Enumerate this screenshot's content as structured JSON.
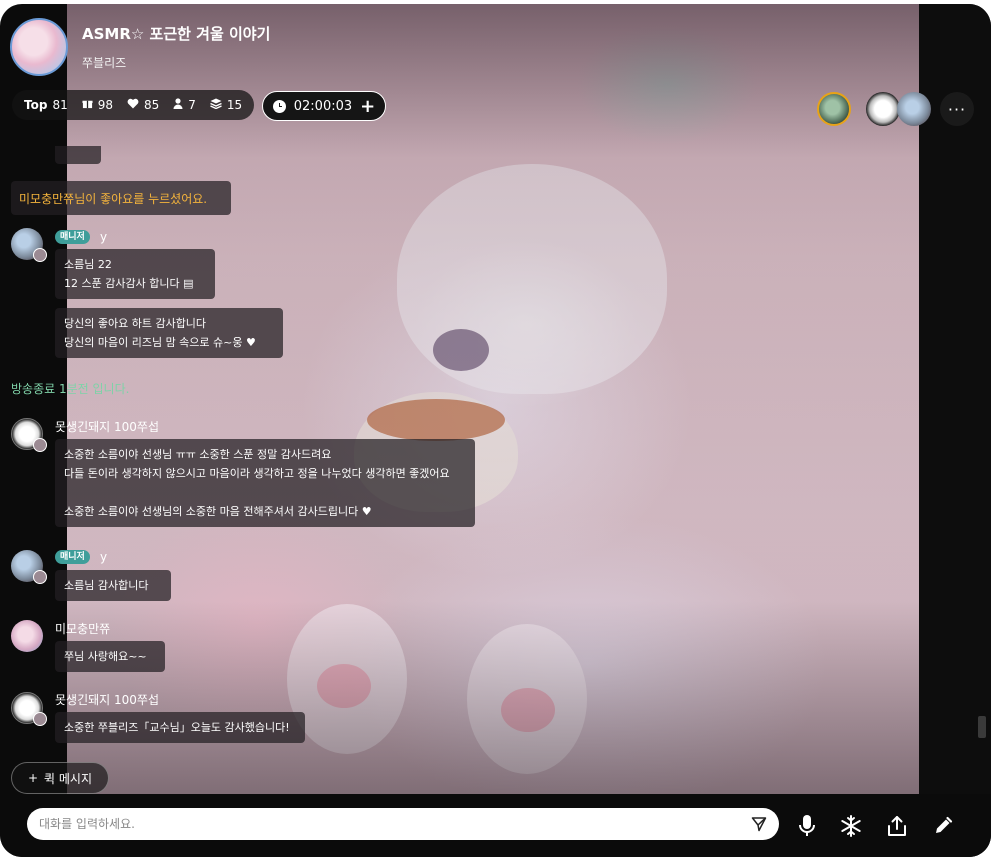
{
  "header": {
    "title": "ASMR☆ 포근한 겨울 이야기",
    "streamer": "쭈블리즈"
  },
  "stats": {
    "top_label": "Top",
    "top_value": "81",
    "gift": "98",
    "likes": "85",
    "viewers": "7",
    "layers": "15"
  },
  "timer": {
    "time": "02:00:03",
    "plus": "+"
  },
  "more": {
    "label": "···"
  },
  "chat": {
    "like_notice": "미모충만쮸님이 좋아요를 누르셨어요.",
    "manager_tag": "매니저",
    "msg1": {
      "name": "y",
      "bubble1": "소름님 22\n12 스푼 감사감사 합니다 ▤",
      "bubble2": "당신의 좋아요 하트 감사합니다\n당신의 마음이 리즈님 맘 속으로 슈~웅 ♥"
    },
    "end_notice": "방송종료 1분전 입니다.",
    "msg2": {
      "name": "못생긴돼지 100쭈섭",
      "bubble": "소중한 소름이야 선생님 ㅠㅠ 소중한 스푼 정말 감사드려요\n다들 돈이라 생각하지 않으시고 마음이라 생각하고 정을 나누었다 생각하면 좋겠어요\n\n소중한 소름이야 선생님의 소중한 마음 전해주셔서 감사드립니다 ♥"
    },
    "msg3": {
      "name": "y",
      "bubble": "소름님 감사합니다"
    },
    "msg4": {
      "name": "미모충만쮸",
      "bubble": "쭈님 사랑해요~~"
    },
    "msg5": {
      "name": "못생긴돼지 100쭈섭",
      "bubble": "소중한 쭈블리즈「교수님」오늘도 감사했습니다!"
    }
  },
  "quick_message": {
    "label": "퀵 메시지",
    "plus": "+"
  },
  "input": {
    "placeholder": "대화를 입력하세요."
  },
  "colors": {
    "like_notice": "#f5b43c",
    "end_notice": "#7fd2a8",
    "manager_tag": "#3f9e9a"
  }
}
